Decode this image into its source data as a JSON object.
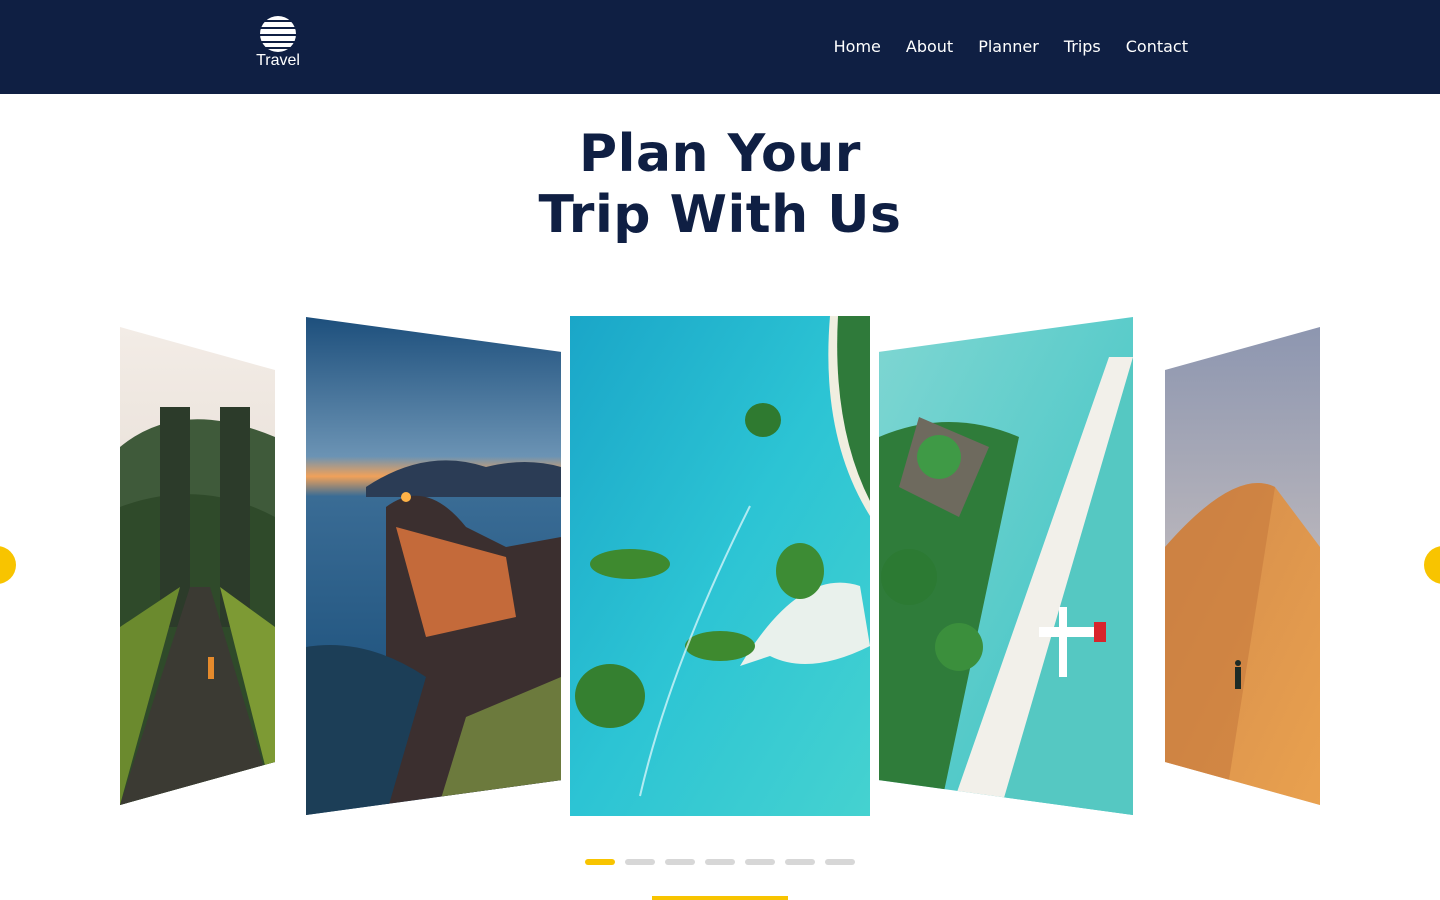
{
  "brand": {
    "name": "Travel",
    "logo_icon": "striped-globe-icon",
    "colors": {
      "navy": "#0f1f43",
      "accent_yellow": "#f8c400",
      "inactive_dot": "#d7d7d7"
    }
  },
  "nav": {
    "items": [
      {
        "label": "Home"
      },
      {
        "label": "About"
      },
      {
        "label": "Planner"
      },
      {
        "label": "Trips"
      },
      {
        "label": "Contact"
      }
    ]
  },
  "hero": {
    "title_line1": "Plan Your",
    "title_line2": "Trip With Us"
  },
  "carousel": {
    "slides": [
      {
        "image": "temple-gate-road-photo"
      },
      {
        "image": "cliff-village-sunset-photo"
      },
      {
        "image": "turquoise-lagoon-islands-photo"
      },
      {
        "image": "beach-resort-seaplane-photo"
      },
      {
        "image": "desert-dune-walker-photo"
      }
    ],
    "prev_icon": "chevron-left-icon",
    "next_icon": "chevron-right-icon",
    "pagination": {
      "total": 7,
      "active_index": 0
    }
  }
}
